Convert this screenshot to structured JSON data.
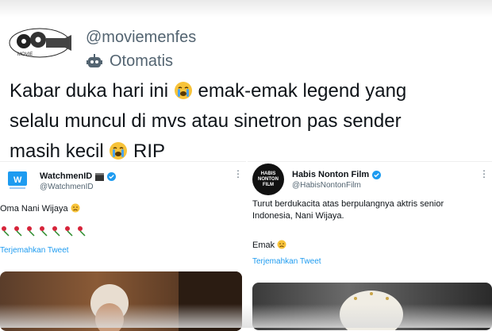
{
  "tweet": {
    "handle": "@moviemenfes",
    "automation_label": "Otomatis",
    "line1_a": "Kabar duka hari ini ",
    "line1_b": " emak-emak legend yang",
    "line2": "selalu muncul di mvs atau sinetron pas sender",
    "line3_a": "masih kecil ",
    "line3_b": " RIP",
    "emoji": "crying-face"
  },
  "cards": [
    {
      "name": "WatchmenID",
      "name_emoji": "clapper-board",
      "handle": "@WatchmenID",
      "text": "Oma Nani Wijaya",
      "text_emoji": "disappointed-face",
      "rose_count": 7,
      "translate": "Terjemahkan Tweet",
      "verified": true
    },
    {
      "name": "Habis Nonton Film",
      "handle": "@HabisNontonFilm",
      "logo_text": "HABIS NONTON FILM",
      "text": "Turut berdukacita atas berpulangnya aktris senior Indonesia, Nani Wijaya.",
      "text2": "Emak",
      "text_emoji": "disappointed-face",
      "translate": "Terjemahkan Tweet",
      "verified": true
    }
  ],
  "colors": {
    "link_blue": "#1d9bf0",
    "secondary_text": "#536471",
    "primary_text": "#0f1419"
  }
}
